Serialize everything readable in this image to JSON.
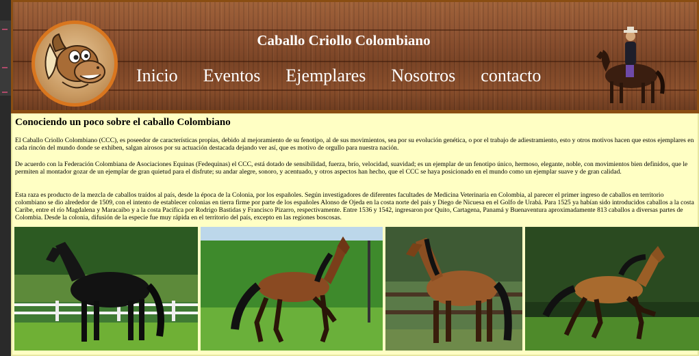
{
  "header": {
    "title": "Caballo Criollo Colombiano",
    "nav": [
      "Inicio",
      "Eventos",
      "Ejemplares",
      "Nosotros",
      "contacto"
    ]
  },
  "main": {
    "heading": "Conociendo un poco sobre el caballo Colombiano",
    "paragraphs": [
      "El Caballo Criollo Colombiano (CCC), es poseedor de características propias, debido al mejoramiento de su fenotipo, al de sus movimientos, sea por su evolución genética, o por el trabajo de adiestramiento, esto y otros motivos hacen que estos ejemplares en cada rincón del mundo donde se exhiben, salgan airosos por su actuación destacada dejando ver así, que es motivo de orgullo para nuestra nación.",
      "De acuerdo con la Federación Colombiana de Asociaciones Equinas (Fedequinas) el CCC, está dotado de sensibilidad, fuerza, brío, velocidad, suavidad; es un ejemplar de un fenotipo único, hermoso, elegante, noble, con movimientos bien definidos, que le permiten al montador gozar de un ejemplar de gran quietud para el disfrute; su andar alegre, sonoro, y acentuado, y otros aspectos han hecho, que el CCC se haya posicionado en el mundo como un ejemplar suave y de gran calidad.",
      "Esta raza es producto de la mezcla de caballos traídos al país, desde la época de la Colonia, por los españoles. Según investigadores de diferentes facultades de Medicina Veterinaria en Colombia, al parecer el primer ingreso de caballos en territorio colombiano se dio alrededor de 1509, con el intento de establecer colonias en tierra firme por parte de los españoles Alonso de Ojeda en la costa norte del país y Diego de Nicuesa en el Golfo de Urabá. Para 1525 ya habían sido introducidos caballos a la costa Caribe, entre el río Magdalena y Maracaibo y a la costa Pacífica por Rodrigo Bastidas y Francisco Pizarro, respectivamente. Entre 1536 y 1542, ingresaron por Quito, Cartagena, Panamá y Buenaventura aproximadamente 813 caballos a diversas partes de Colombia. Desde la colonia, difusión de la especie fue muy rápida en el territorio del país, excepto en las regiones boscosas."
    ]
  },
  "colors": {
    "content_bg": "#ffffc4",
    "header_border": "#8a4e12",
    "logo_ring": "#d9761e"
  },
  "icons": {
    "logo": "cartoon-horse-logo",
    "rider": "horse-rider-photo"
  }
}
